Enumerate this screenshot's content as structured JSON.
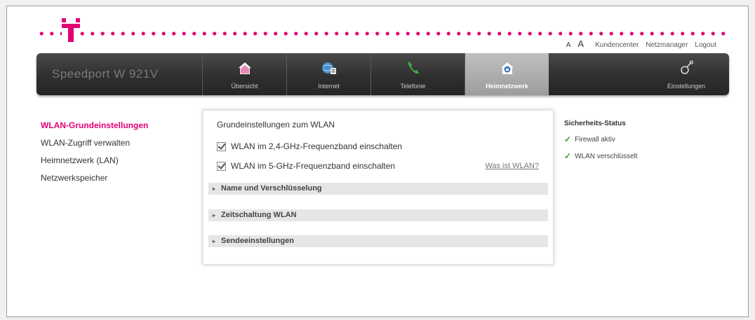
{
  "header": {
    "font_small": "A",
    "font_large": "A",
    "links": [
      "Kundencenter",
      "Netzmanager",
      "Logout"
    ],
    "brand_color": "#e20074"
  },
  "nav": {
    "product": "Speedport W 921V",
    "items": [
      {
        "label": "Übersicht",
        "icon": "home-icon"
      },
      {
        "label": "Internet",
        "icon": "internet-globe-icon"
      },
      {
        "label": "Telefonie",
        "icon": "phone-icon"
      },
      {
        "label": "Heimnetzwerk",
        "icon": "home-network-icon",
        "active": true
      },
      {
        "label": "Einstellungen",
        "icon": "settings-wrench-icon"
      }
    ]
  },
  "sidebar": {
    "items": [
      {
        "label": "WLAN-Grundeinstellungen",
        "active": true
      },
      {
        "label": "WLAN-Zugriff verwalten"
      },
      {
        "label": "Heimnetzwerk (LAN)"
      },
      {
        "label": "Netzwerkspeicher"
      }
    ]
  },
  "main": {
    "title": "Grundeinstellungen zum WLAN",
    "checkboxes": [
      {
        "label": "WLAN im 2,4-GHz-Frequenzband einschalten",
        "checked": true
      },
      {
        "label": "WLAN im 5-GHz-Frequenzband einschalten",
        "checked": true
      }
    ],
    "help_link": "Was ist WLAN?",
    "sections": [
      "Name und Verschlüsselung",
      "Zeitschaltung WLAN",
      "Sendeeinstellungen"
    ]
  },
  "status": {
    "title": "Sicherheits-Status",
    "items": [
      "Firewall aktiv",
      "WLAN verschlüsselt"
    ],
    "ok_color": "#3a9a28"
  }
}
